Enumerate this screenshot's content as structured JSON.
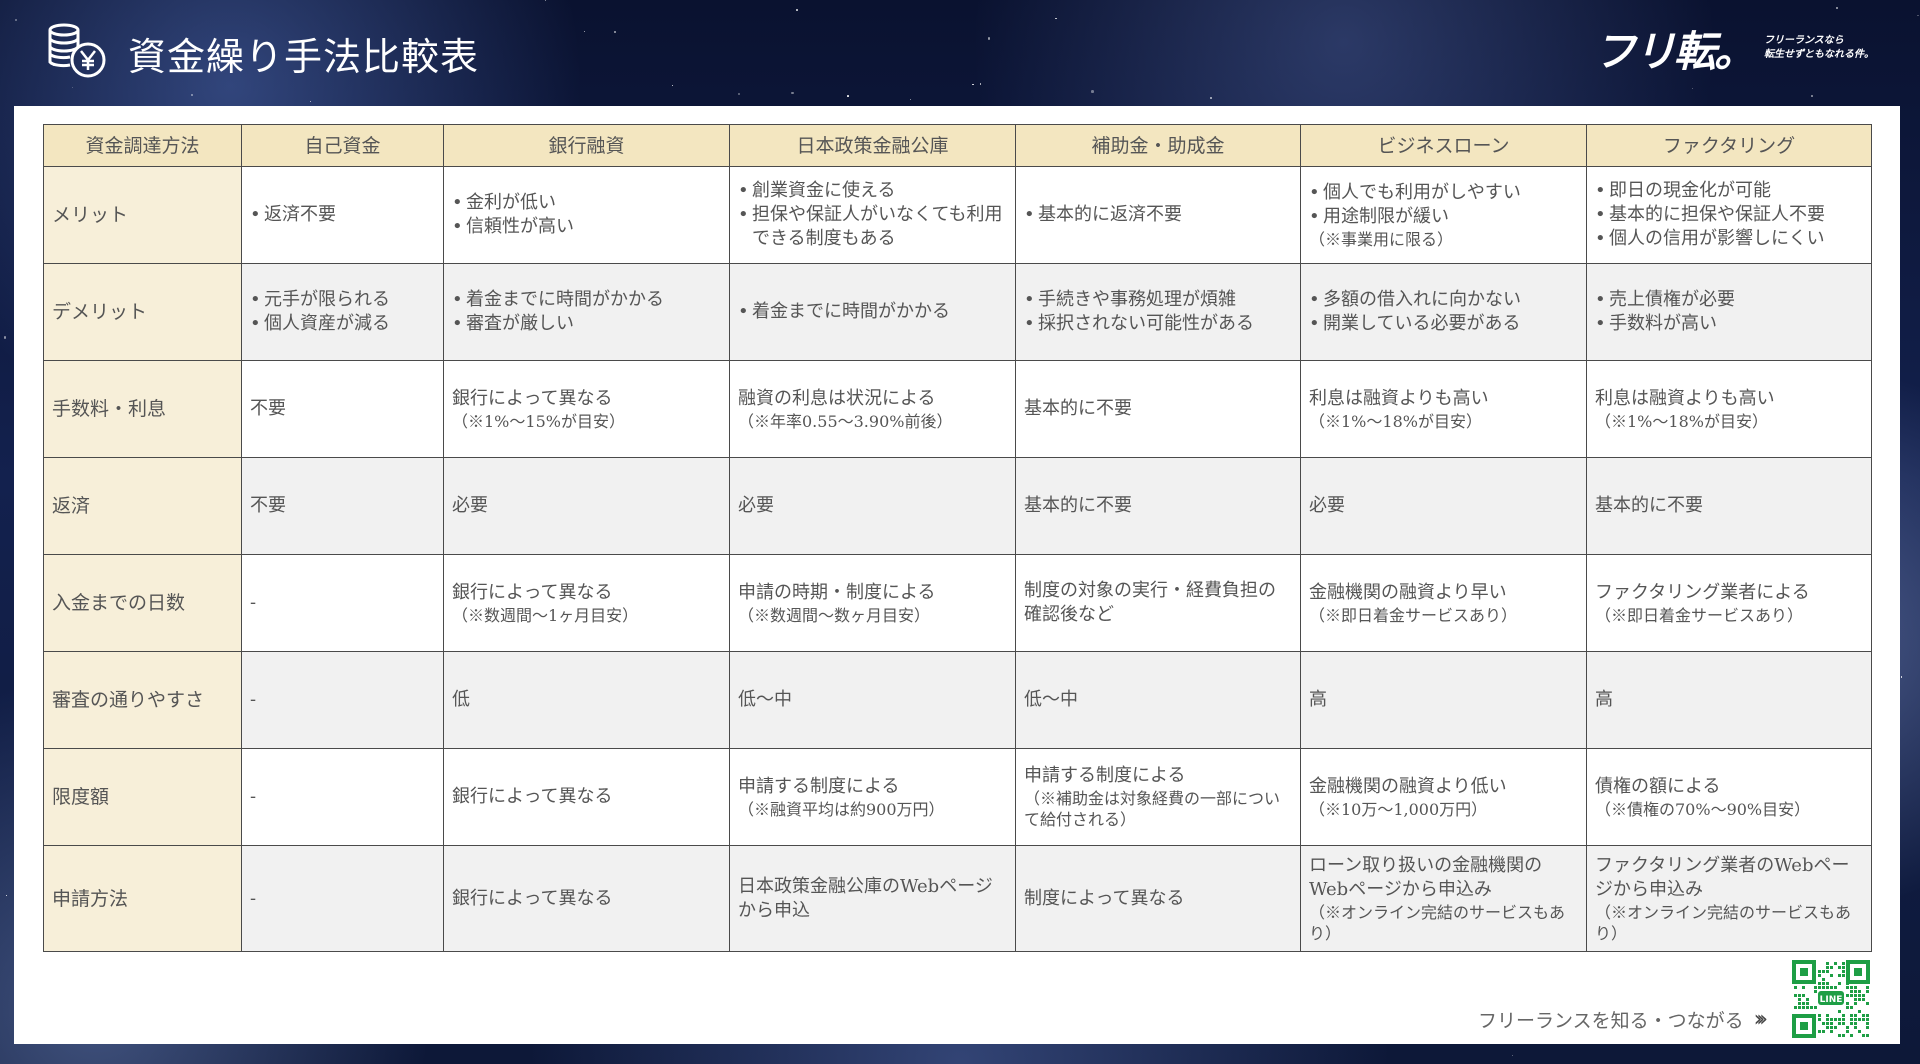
{
  "header": {
    "title": "資金繰り手法比較表",
    "brand_logo": "フリ転。",
    "brand_tagline": "フリーランスなら\n転生せずともなれる件。"
  },
  "table": {
    "corner": "資金調達方法",
    "columns": [
      "自己資金",
      "銀行融資",
      "日本政策金融公庫",
      "補助金・助成金",
      "ビジネスローン",
      "ファクタリング"
    ],
    "rows": [
      {
        "label": "メリット",
        "cells": [
          {
            "bullets": [
              "返済不要"
            ]
          },
          {
            "bullets": [
              "金利が低い",
              "信頼性が高い"
            ]
          },
          {
            "bullets": [
              "創業資金に使える",
              "担保や保証人がいなくても利用できる制度もある"
            ]
          },
          {
            "bullets": [
              "基本的に返済不要"
            ]
          },
          {
            "bullets": [
              "個人でも利用がしやすい",
              "用途制限が緩い"
            ],
            "note": "（※事業用に限る）"
          },
          {
            "bullets": [
              "即日の現金化が可能",
              "基本的に担保や保証人不要",
              "個人の信用が影響しにくい"
            ]
          }
        ]
      },
      {
        "label": "デメリット",
        "cells": [
          {
            "bullets": [
              "元手が限られる",
              "個人資産が減る"
            ]
          },
          {
            "bullets": [
              "着金までに時間がかかる",
              "審査が厳しい"
            ]
          },
          {
            "bullets": [
              "着金までに時間がかかる"
            ]
          },
          {
            "bullets": [
              "手続きや事務処理が煩雑",
              "採択されない可能性がある"
            ]
          },
          {
            "bullets": [
              "多額の借入れに向かない",
              "開業している必要がある"
            ]
          },
          {
            "bullets": [
              "売上債権が必要",
              "手数料が高い"
            ]
          }
        ]
      },
      {
        "label": "手数料・利息",
        "cells": [
          {
            "text": "不要"
          },
          {
            "text": "銀行によって異なる",
            "note": "（※1%～15%が目安）"
          },
          {
            "text": "融資の利息は状況による",
            "note": "（※年率0.55～3.90%前後）"
          },
          {
            "text": "基本的に不要"
          },
          {
            "text": "利息は融資よりも高い",
            "note": "（※1%～18%が目安）"
          },
          {
            "text": "利息は融資よりも高い",
            "note": "（※1%～18%が目安）"
          }
        ]
      },
      {
        "label": "返済",
        "cells": [
          {
            "text": "不要"
          },
          {
            "text": "必要"
          },
          {
            "text": "必要"
          },
          {
            "text": "基本的に不要"
          },
          {
            "text": "必要"
          },
          {
            "text": "基本的に不要"
          }
        ]
      },
      {
        "label": "入金までの日数",
        "cells": [
          {
            "text": "-"
          },
          {
            "text": "銀行によって異なる",
            "note": "（※数週間～1ヶ月目安）"
          },
          {
            "text": "申請の時期・制度による",
            "note": "（※数週間～数ヶ月目安）"
          },
          {
            "text": "制度の対象の実行・経費負担の確認後など"
          },
          {
            "text": "金融機関の融資より早い",
            "note": "（※即日着金サービスあり）"
          },
          {
            "text": "ファクタリング業者による",
            "note": "（※即日着金サービスあり）"
          }
        ]
      },
      {
        "label": "審査の通りやすさ",
        "cells": [
          {
            "text": "-"
          },
          {
            "text": "低"
          },
          {
            "text": "低～中"
          },
          {
            "text": "低～中"
          },
          {
            "text": "高"
          },
          {
            "text": "高"
          }
        ]
      },
      {
        "label": "限度額",
        "cells": [
          {
            "text": "-"
          },
          {
            "text": "銀行によって異なる"
          },
          {
            "text": "申請する制度による",
            "note": "（※融資平均は約900万円）"
          },
          {
            "text": "申請する制度による",
            "note": "（※補助金は対象経費の一部について給付される）"
          },
          {
            "text": "金融機関の融資より低い",
            "note": "（※10万～1,000万円）"
          },
          {
            "text": "債権の額による",
            "note": "（※債権の70%～90%目安）"
          }
        ]
      },
      {
        "label": "申請方法",
        "cells": [
          {
            "text": "-"
          },
          {
            "text": "銀行によって異なる"
          },
          {
            "text": "日本政策金融公庫のWebページから申込"
          },
          {
            "text": "制度によって異なる"
          },
          {
            "text": "ローン取り扱いの金融機関のWebページから申込み",
            "note": "（※オンライン完結のサービスもあり）"
          },
          {
            "text": "ファクタリング業者のWebページから申込み",
            "note": "（※オンライン完結のサービスもあり）"
          }
        ]
      }
    ]
  },
  "footer": {
    "link_text": "フリーランスを知る・つながる",
    "qr_label": "LINE"
  },
  "icons": {
    "header": "coins-yen-icon",
    "link": "chevrons-right-icon",
    "qr": "qr-code-icon"
  }
}
